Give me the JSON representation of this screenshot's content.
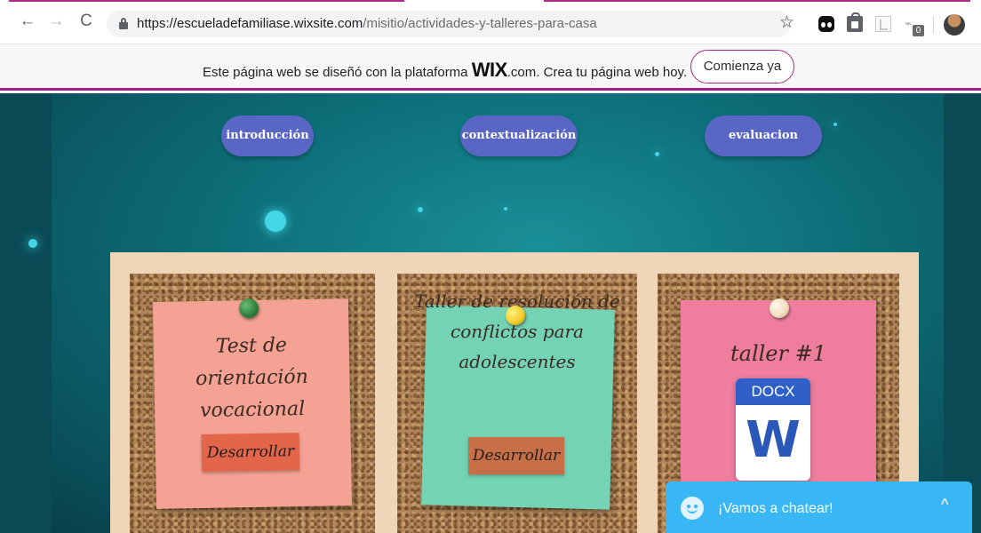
{
  "browser": {
    "back_glyph": "←",
    "forward_glyph": "→",
    "reload_glyph": "C",
    "url_host": "https://escueladefamiliase.wixsite.com",
    "url_path": "/misitio/actividades-y-talleres-para-casa",
    "star_glyph": "☆",
    "extension_badge": "0",
    "extension_glyph": "⌁",
    "icons": [
      "back-arrow-icon",
      "forward-arrow-icon",
      "reload-icon",
      "lock-icon",
      "bookmark-star-icon",
      "panda-extension-icon",
      "shopping-bag-extension-icon",
      "pdf-extension-icon",
      "counter-extension-icon",
      "profile-avatar"
    ]
  },
  "wix_banner": {
    "text_before": "Este página web se diseñó con la plataforma ",
    "logo": "WIX",
    "logo_suffix": ".com",
    "text_after": ". Crea tu página web hoy.",
    "cta_label": "Comienza ya",
    "accent_color": "#a51f87"
  },
  "nav": {
    "items": [
      {
        "label": "introducción"
      },
      {
        "label": "contextualización"
      },
      {
        "label": "evaluacion"
      }
    ],
    "pill_color": "#5a66c4"
  },
  "cards": [
    {
      "title": "Test de orientación vocacional",
      "button": "Desarrollar",
      "note_color": "#f3a294",
      "pin_color": "#2e7d3b",
      "button_color": "#e3654a"
    },
    {
      "title": "Taller de resolución de conflictos para adolescentes",
      "button": "Desarrollar",
      "note_color": "#74d2b5",
      "pin_color": "#f2cb2a",
      "button_color": "#c96f47"
    },
    {
      "title": "taller #1",
      "file_type": "DOCX",
      "file_letter": "W",
      "note_color": "#ee7d9e",
      "pin_color": "#efdcbf"
    }
  ],
  "chat": {
    "label": "¡Vamos a chatear!",
    "caret": "^",
    "color": "#39b7f5"
  }
}
